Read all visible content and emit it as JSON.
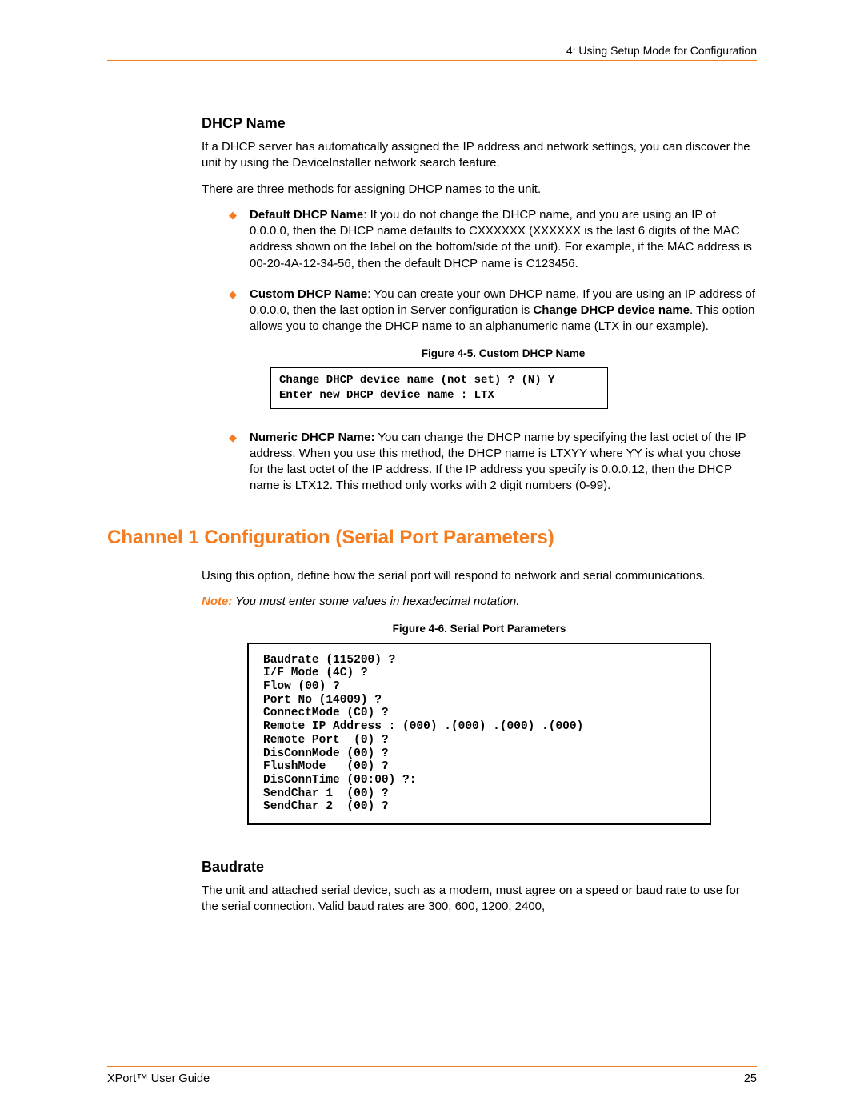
{
  "header": {
    "running": "4: Using Setup Mode for Configuration"
  },
  "section1": {
    "title": "DHCP Name",
    "p1": "If a DHCP server has automatically assigned the IP address and network settings, you can discover the unit by using the DeviceInstaller network search feature.",
    "p2": "There are three methods for assigning DHCP names to the unit.",
    "bullets": {
      "b1_title": "Default DHCP Name",
      "b1_body": ":  If you do not change the DHCP name, and you are using an IP of 0.0.0.0, then the DHCP name defaults to CXXXXXX (XXXXXX is the last 6 digits of the MAC address shown on the label on the bottom/side of the unit). For example, if the MAC address is 00-20-4A-12-34-56, then the default DHCP name is C123456.",
      "b2_title": "Custom DHCP Name",
      "b2_pre": ":  You can create your own DHCP name. If you are using an IP address of 0.0.0.0, then the last option in Server configuration is ",
      "b2_bold": "Change DHCP device name",
      "b2_post": ". This option allows you to change the DHCP name to an alphanumeric name (LTX in our example).",
      "fig1_cap": "Figure 4-5. Custom DHCP Name",
      "fig1_code": "Change DHCP device name (not set) ? (N) Y\nEnter new DHCP device name : LTX",
      "b3_title": "Numeric DHCP Name:",
      "b3_body": "  You can change the DHCP name by specifying the last octet of the IP address. When you use this method, the DHCP name is LTXYY where YY is what you chose for the last octet of the IP address. If the IP address you specify is 0.0.0.12, then the DHCP name is LTX12. This method only works with 2 digit numbers (0-99)."
    }
  },
  "section2": {
    "title": "Channel 1 Configuration (Serial Port Parameters)",
    "p1": "Using this option, define how the serial port will respond to network and serial communications.",
    "note_lead": "Note:",
    "note_rest": " You must enter some values in hexadecimal notation.",
    "fig2_cap": "Figure 4-6.  Serial Port Parameters",
    "term": "Baudrate (115200) ?\nI/F Mode (4C) ?\nFlow (00) ?\nPort No (14009) ?\nConnectMode (C0) ?\nRemote IP Address : (000) .(000) .(000) .(000)\nRemote Port  (0) ?\nDisConnMode (00) ?\nFlushMode   (00) ?\nDisConnTime (00:00) ?:\nSendChar 1  (00) ?\nSendChar 2  (00) ?"
  },
  "section3": {
    "title": "Baudrate",
    "p1": "The unit and attached serial device, such as a modem, must agree on a speed or baud rate to use for the serial connection. Valid baud rates are 300, 600, 1200, 2400,"
  },
  "footer": {
    "left": "XPort™ User Guide",
    "right": "25"
  }
}
